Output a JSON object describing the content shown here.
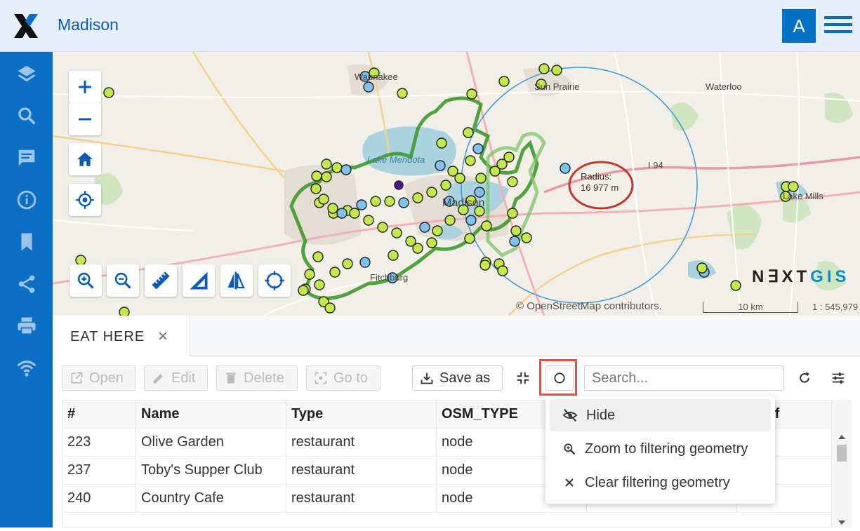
{
  "header": {
    "title": "Madison",
    "avatar_letter": "A"
  },
  "sidebar": {
    "items": [
      "layers-icon",
      "search-icon",
      "chat-icon",
      "info-icon",
      "bookmark-icon",
      "share-icon",
      "print-icon",
      "wifi-icon"
    ]
  },
  "map": {
    "labels": [
      "Waunakee",
      "Sun Prairie",
      "Waterloo",
      "Lake Mendota",
      "I 94",
      "Madison",
      "Fitchburg",
      "Lake Mills"
    ],
    "radius_label": "Radius:",
    "radius_value": "16 977 m",
    "brand_main": "N∃XT",
    "brand_accent": "GIS",
    "attribution": "© OpenStreetMap contributors.",
    "scale_text": "10 km",
    "scale_ratio": "1 : 545,979"
  },
  "panel": {
    "tab_label": "EAT HERE",
    "toolbar": {
      "open": "Open",
      "edit": "Edit",
      "delete": "Delete",
      "goto": "Go to",
      "save_as": "Save as"
    },
    "search_placeholder": "Search..."
  },
  "table": {
    "columns": [
      "#",
      "Name",
      "Type",
      "OSM_TYPE",
      "",
      "ogc_f"
    ],
    "rows": [
      {
        "id": "223",
        "name": "Olive Garden",
        "type": "restaurant",
        "osm": "node"
      },
      {
        "id": "237",
        "name": "Toby's Supper Club",
        "type": "restaurant",
        "osm": "node"
      },
      {
        "id": "240",
        "name": "Country Cafe",
        "type": "restaurant",
        "osm": "node"
      }
    ]
  },
  "filter_menu": {
    "items": [
      "Hide",
      "Zoom to filtering geometry",
      "Clear filtering geometry"
    ]
  },
  "colors": {
    "brand": "#0c6fc6",
    "highlight": "#d9534f",
    "point_green": "#c3e84a",
    "point_blue": "#7ec3ee",
    "boundary": "#3f9a2e"
  }
}
